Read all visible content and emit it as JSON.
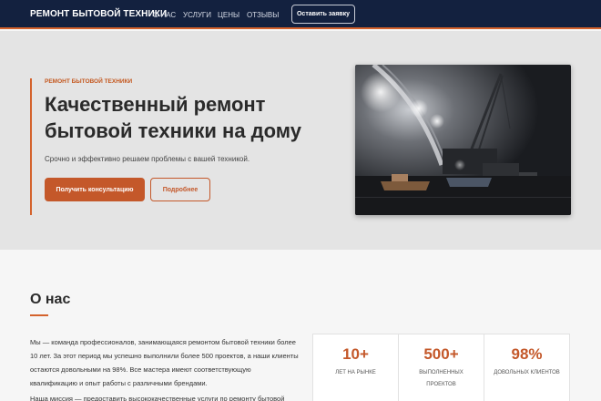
{
  "nav": {
    "brand": "РЕМОНТ БЫТОВОЙ ТЕХНИКИ",
    "links": [
      "О НАС",
      "УСЛУГИ",
      "ЦЕНЫ",
      "ОТЗЫВЫ"
    ],
    "cta": "Оставить заявку"
  },
  "hero": {
    "eyebrow": "РЕМОНТ БЫТОВОЙ ТЕХНИКИ",
    "title": "Качественный ремонт бытовой техники на дому",
    "subtitle": "Срочно и эффективно решаем проблемы с вашей техникой.",
    "primary_button": "Получить консультацию",
    "secondary_button": "Подробнее"
  },
  "about": {
    "title": "О нас",
    "paragraph1": "Мы — команда профессионалов, занимающаяся ремонтом бытовой техники более 10 лет. За этот период мы успешно выполнили более 500 проектов, а наши клиенты остаются довольными на 98%. Все мастера имеют соответствующую квалификацию и опыт работы с различными брендами.",
    "paragraph2": "Наша миссия — предоставить высококачественные услуги по ремонту бытовой техники на",
    "stats": [
      {
        "value": "10+",
        "label": "ЛЕТ НА РЫНКЕ"
      },
      {
        "value": "500+",
        "label": "ВЫПОЛНЕННЫХ ПРОЕКТОВ"
      },
      {
        "value": "98%",
        "label": "ДОВОЛЬНЫХ КЛИЕНТОВ"
      }
    ]
  },
  "colors": {
    "navy": "#13213f",
    "accent": "#c4582a"
  }
}
